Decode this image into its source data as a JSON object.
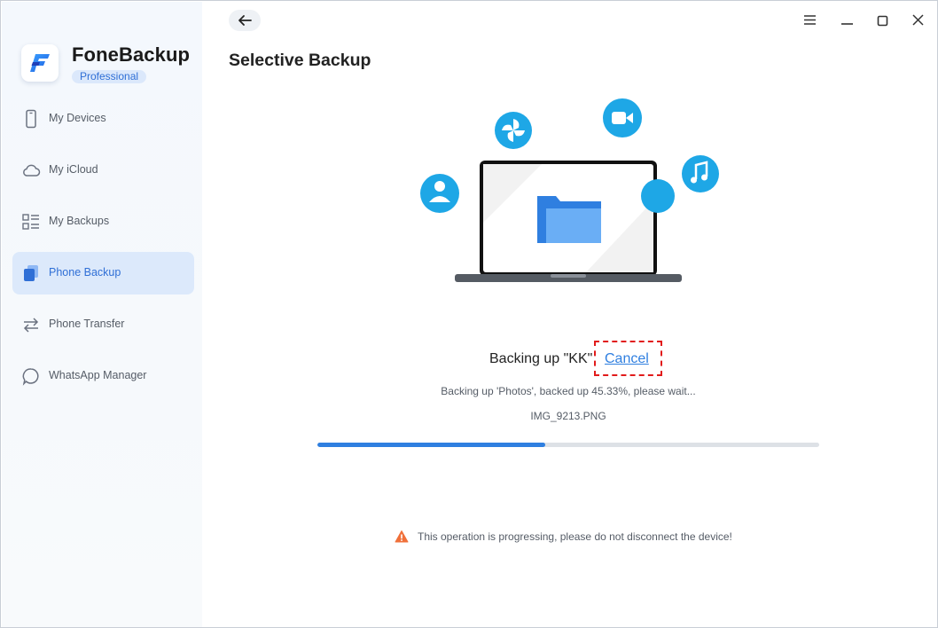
{
  "app": {
    "name": "FoneBackup",
    "edition": "Professional"
  },
  "sidebar": {
    "items": [
      {
        "label": "My Devices",
        "icon": "phone-icon",
        "active": false
      },
      {
        "label": "My iCloud",
        "icon": "cloud-icon",
        "active": false
      },
      {
        "label": "My Backups",
        "icon": "list-icon",
        "active": false
      },
      {
        "label": "Phone Backup",
        "icon": "phone-backup-icon",
        "active": true
      },
      {
        "label": "Phone Transfer",
        "icon": "transfer-arrows-icon",
        "active": false
      },
      {
        "label": "WhatsApp Manager",
        "icon": "chat-bubble-icon",
        "active": false
      }
    ]
  },
  "titlebar": {
    "back_icon": "arrow-left-icon",
    "menu_icon": "hamburger-icon",
    "minimize_icon": "minimize-icon",
    "maximize_icon": "maximize-icon",
    "close_icon": "close-icon"
  },
  "page": {
    "title": "Selective Backup"
  },
  "status": {
    "backing_up": "Backing up \"KK\"",
    "cancel_label": "Cancel",
    "progress_text": "Backing up 'Photos', backed up 45.33%, please wait...",
    "current_file": "IMG_9213.PNG",
    "progress_fraction": 0.4533
  },
  "warning": {
    "icon": "warning-triangle-icon",
    "text": "This operation is progressing, please do not disconnect the device!"
  },
  "colors": {
    "accent": "#2f7fe0",
    "active_nav_bg": "#dce9fb",
    "cancel_highlight": "#e11b1b",
    "warning": "#f0703a",
    "bubble": "#1ea7e6"
  }
}
